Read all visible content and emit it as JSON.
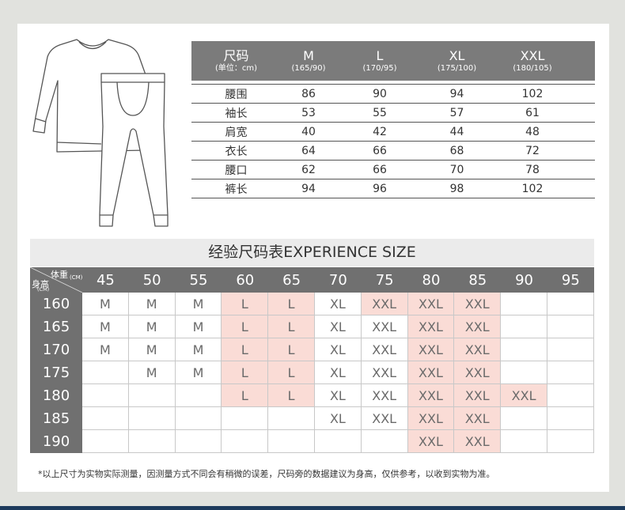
{
  "size_table": {
    "header": {
      "label": "尺码",
      "unit": "(单位：cm)"
    },
    "sizes": [
      {
        "name": "M",
        "spec": "(165/90)"
      },
      {
        "name": "L",
        "spec": "(170/95)"
      },
      {
        "name": "XL",
        "spec": "(175/100)"
      },
      {
        "name": "XXL",
        "spec": "(180/105)"
      }
    ],
    "rows": [
      {
        "label": "腰围",
        "values": [
          "86",
          "90",
          "94",
          "102"
        ]
      },
      {
        "label": "袖长",
        "values": [
          "53",
          "55",
          "57",
          "61"
        ]
      },
      {
        "label": "肩宽",
        "values": [
          "40",
          "42",
          "44",
          "48"
        ]
      },
      {
        "label": "衣长",
        "values": [
          "64",
          "66",
          "68",
          "72"
        ]
      },
      {
        "label": "腰口",
        "values": [
          "62",
          "66",
          "70",
          "78"
        ]
      },
      {
        "label": "裤长",
        "values": [
          "94",
          "96",
          "98",
          "102"
        ]
      }
    ]
  },
  "experience_chart": {
    "title": "经验尺码表EXPERIENCE SIZE",
    "corner": {
      "weight_label": "体重",
      "weight_unit": "(CM)",
      "height_label": "身高",
      "height_unit": "(CM)"
    },
    "weights": [
      "45",
      "50",
      "55",
      "60",
      "65",
      "70",
      "75",
      "80",
      "85",
      "90",
      "95"
    ],
    "rows": [
      {
        "height": "160",
        "cells": [
          "M",
          "M",
          "M",
          "L",
          "L",
          "XL",
          "XXL",
          "XXL",
          "XXL",
          "",
          ""
        ],
        "highlight": [
          0,
          0,
          0,
          1,
          1,
          0,
          1,
          1,
          1,
          0,
          0
        ]
      },
      {
        "height": "165",
        "cells": [
          "M",
          "M",
          "M",
          "L",
          "L",
          "XL",
          "XXL",
          "XXL",
          "XXL",
          "",
          ""
        ],
        "highlight": [
          0,
          0,
          0,
          1,
          1,
          0,
          0,
          1,
          1,
          0,
          0
        ]
      },
      {
        "height": "170",
        "cells": [
          "M",
          "M",
          "M",
          "L",
          "L",
          "XL",
          "XXL",
          "XXL",
          "XXL",
          "",
          ""
        ],
        "highlight": [
          0,
          0,
          0,
          1,
          1,
          0,
          0,
          1,
          1,
          0,
          0
        ]
      },
      {
        "height": "175",
        "cells": [
          "",
          "M",
          "M",
          "L",
          "L",
          "XL",
          "XXL",
          "XXL",
          "XXL",
          "",
          ""
        ],
        "highlight": [
          0,
          0,
          0,
          1,
          1,
          0,
          0,
          1,
          1,
          0,
          0
        ]
      },
      {
        "height": "180",
        "cells": [
          "",
          "",
          "",
          "L",
          "L",
          "XL",
          "XXL",
          "XXL",
          "XXL",
          "XXL",
          ""
        ],
        "highlight": [
          0,
          0,
          0,
          1,
          1,
          0,
          0,
          1,
          1,
          1,
          0
        ]
      },
      {
        "height": "185",
        "cells": [
          "",
          "",
          "",
          "",
          "",
          "XL",
          "XXL",
          "XXL",
          "XXL",
          "",
          ""
        ],
        "highlight": [
          0,
          0,
          0,
          0,
          0,
          0,
          0,
          1,
          1,
          0,
          0
        ]
      },
      {
        "height": "190",
        "cells": [
          "",
          "",
          "",
          "",
          "",
          "",
          "",
          "XXL",
          "XXL",
          "",
          ""
        ],
        "highlight": [
          0,
          0,
          0,
          0,
          0,
          0,
          0,
          1,
          1,
          0,
          0
        ]
      }
    ]
  },
  "footnote": "*以上尺寸为实物实际测量，因测量方式不同会有稍微的误差，尺码旁的数据建议为身高，仅供参考，以收到实物为准。",
  "illustration": {
    "icon": "thermal-underwear-set-icon"
  },
  "colors": {
    "header_gray": "#7b7b7b",
    "highlight_pink": "#fadcd6",
    "accent_navy": "#1d3a5c"
  }
}
